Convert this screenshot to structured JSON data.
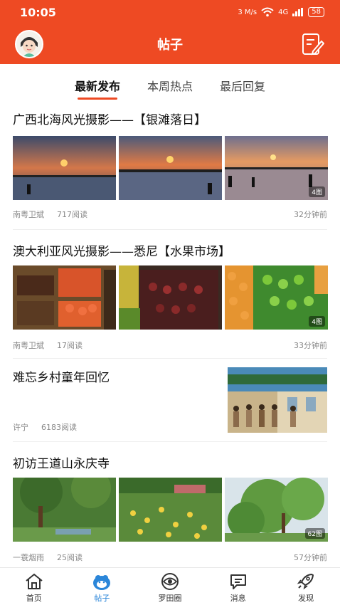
{
  "status": {
    "time": "10:05",
    "net_speed": "3 M/s",
    "signal": "4G",
    "battery": "58"
  },
  "header": {
    "title": "帖子"
  },
  "tabs": [
    {
      "label": "最新发布",
      "active": true
    },
    {
      "label": "本周热点",
      "active": false
    },
    {
      "label": "最后回复",
      "active": false
    }
  ],
  "posts": [
    {
      "title": "广西北海风光摄影——【银滩落日】",
      "author": "南粤卫斌",
      "reads": "717阅读",
      "time": "32分钟前",
      "count": "4图"
    },
    {
      "title": "澳大利亚风光摄影——悉尼【水果市场】",
      "author": "南粤卫斌",
      "reads": "17阅读",
      "time": "33分钟前",
      "count": "4图"
    },
    {
      "title": "难忘乡村童年回忆",
      "author": "许宁",
      "reads": "6183阅读",
      "time": "",
      "count": ""
    },
    {
      "title": "初访王道山永庆寺",
      "author": "一蓑烟雨",
      "reads": "25阅读",
      "time": "57分钟前",
      "count": "62图"
    }
  ],
  "nav": [
    {
      "label": "首页",
      "icon": "home-icon",
      "active": false
    },
    {
      "label": "帖子",
      "icon": "mascot-icon",
      "active": true
    },
    {
      "label": "罗田圈",
      "icon": "eye-circle-icon",
      "active": false
    },
    {
      "label": "消息",
      "icon": "chat-icon",
      "active": false
    },
    {
      "label": "发现",
      "icon": "rocket-icon",
      "active": false
    }
  ],
  "colors": {
    "brand": "#ee4a23",
    "active_nav": "#2b86d9"
  }
}
